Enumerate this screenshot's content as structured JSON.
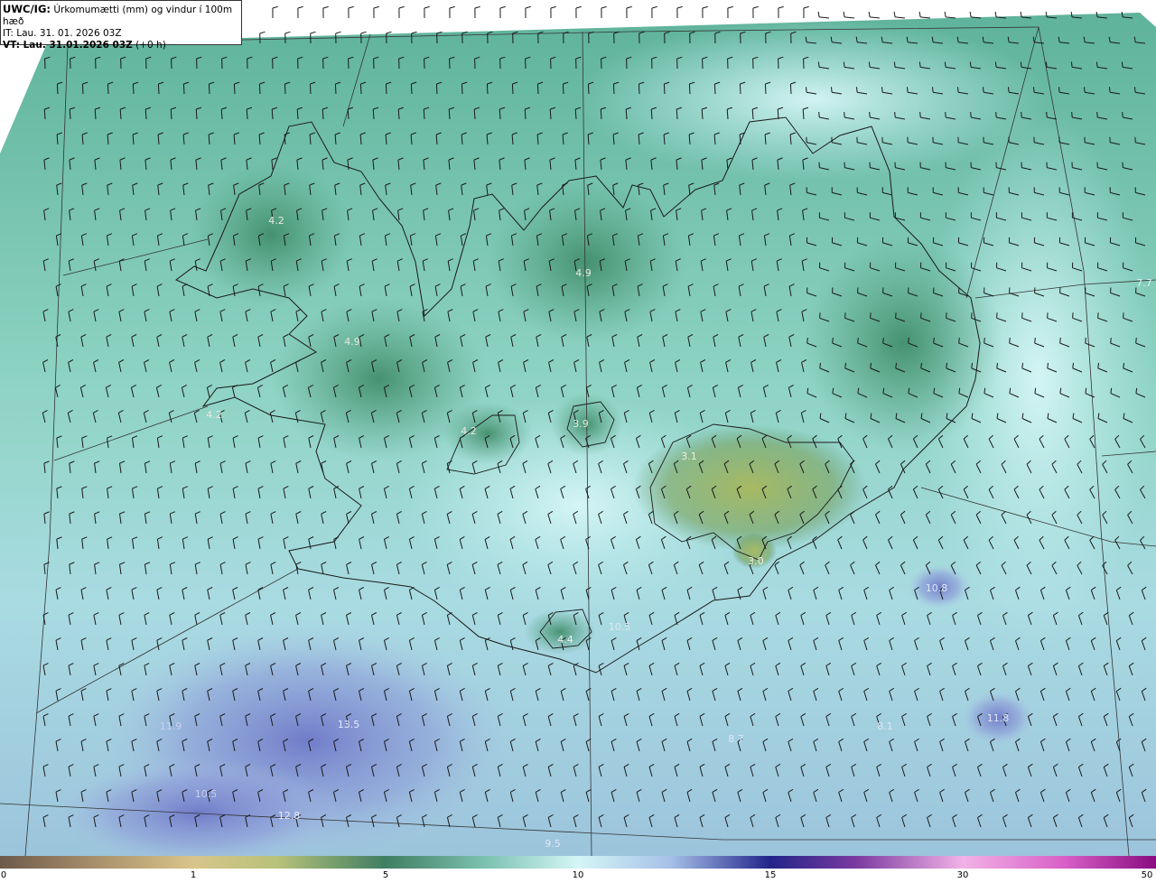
{
  "header": {
    "product": "UWC/IG:",
    "description": "Úrkomumætti (mm) og vindur í 100m hæð",
    "issue_time": "IT: Lau. 31. 01. 2026 03Z",
    "valid_label": "VT: Lau. 31.01.2026 03Z",
    "valid_offset": "(+0 h)"
  },
  "colorbar": {
    "ticks": [
      {
        "label": "0",
        "value": 0
      },
      {
        "label": "1",
        "value": 1
      },
      {
        "label": "5",
        "value": 5
      },
      {
        "label": "10",
        "value": 10
      },
      {
        "label": "15",
        "value": 15
      },
      {
        "label": "30",
        "value": 30
      },
      {
        "label": "50",
        "value": 50
      }
    ],
    "colors": [
      "#6e5a4a",
      "#a68e6a",
      "#d8c48a",
      "#c7d07a",
      "#8fbd79",
      "#3f8a6a",
      "#6fb8a6",
      "#c8f2f2",
      "#a9c6e6",
      "#7b86d2",
      "#2a2a8c",
      "#9a4aa8",
      "#e070c8",
      "#f0a0e0",
      "#a01890"
    ]
  },
  "map_labels": [
    {
      "text": "4.2",
      "color": "#e8e8e0"
    },
    {
      "text": "4.9",
      "color": "#e8e8e0"
    },
    {
      "text": "4.9",
      "color": "#e8e8e0"
    },
    {
      "text": "4.2",
      "color": "#e8e8e0"
    },
    {
      "text": "4.2",
      "color": "#e8e8e0"
    },
    {
      "text": "3.9",
      "color": "#e8e8e0"
    },
    {
      "text": "3.1",
      "color": "#f0f0e0"
    },
    {
      "text": "3.0",
      "color": "#f0f0e0"
    },
    {
      "text": "4.4",
      "color": "#f0f0f0"
    },
    {
      "text": "7.7",
      "color": "#e0f0f0"
    },
    {
      "text": "10.8",
      "color": "#dce8f4"
    },
    {
      "text": "10.5",
      "color": "#dce8f4"
    },
    {
      "text": "11.8",
      "color": "#dce8f4"
    },
    {
      "text": "8.1",
      "color": "#dce8f4"
    },
    {
      "text": "8.7",
      "color": "#dce8f4"
    },
    {
      "text": "11.9",
      "color": "#c8d0f0"
    },
    {
      "text": "13.5",
      "color": "#e8ecff"
    },
    {
      "text": "10.5",
      "color": "#c8d0f0"
    },
    {
      "text": "12.8",
      "color": "#e8ecff"
    },
    {
      "text": "9.5",
      "color": "#dce8f4"
    }
  ]
}
